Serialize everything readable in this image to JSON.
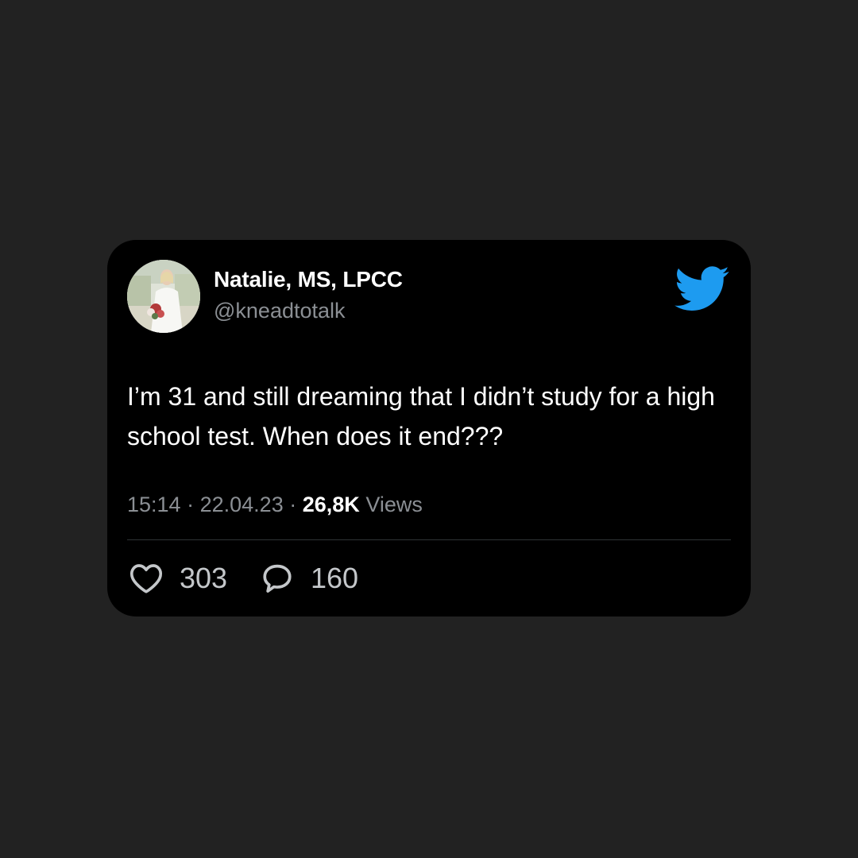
{
  "tweet": {
    "author": {
      "name": "Natalie, MS, LPCC",
      "handle": "@kneadtotalk"
    },
    "text": "I’m 31 and still dreaming that I didn’t study for a high school test. When does it end???",
    "time": "15:14",
    "separator": "·",
    "date": "22.04.23",
    "views_count": "26,8K",
    "views_label": "Views",
    "likes": "303",
    "replies": "160"
  },
  "icons": {
    "brand": "twitter-bird-icon",
    "like": "heart-icon",
    "reply": "comment-bubble-icon"
  },
  "colors": {
    "background": "#222222",
    "card": "#000000",
    "brand": "#1D9BF0",
    "muted": "#8B8F94",
    "text": "#FFFFFF"
  }
}
